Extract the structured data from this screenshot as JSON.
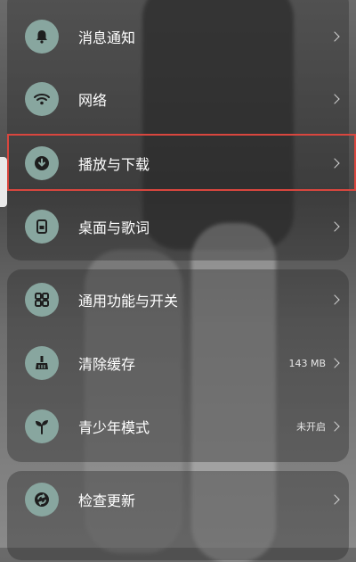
{
  "settings": {
    "groups": [
      {
        "items": [
          {
            "label": "消息通知",
            "value": "",
            "icon": "bell-icon"
          },
          {
            "label": "网络",
            "value": "",
            "icon": "wifi-icon"
          },
          {
            "label": "播放与下载",
            "value": "",
            "icon": "download-icon"
          },
          {
            "label": "桌面与歌词",
            "value": "",
            "icon": "phone-lyrics-icon"
          }
        ]
      },
      {
        "items": [
          {
            "label": "通用功能与开关",
            "value": "",
            "icon": "grid-icon"
          },
          {
            "label": "清除缓存",
            "value": "143 MB",
            "icon": "broom-icon"
          },
          {
            "label": "青少年模式",
            "value": "未开启",
            "icon": "sprout-icon"
          }
        ]
      },
      {
        "items": [
          {
            "label": "检查更新",
            "value": "",
            "icon": "refresh-icon"
          }
        ]
      }
    ]
  },
  "colors": {
    "icon_bg": "#88a69f",
    "highlight": "#d9463e"
  }
}
